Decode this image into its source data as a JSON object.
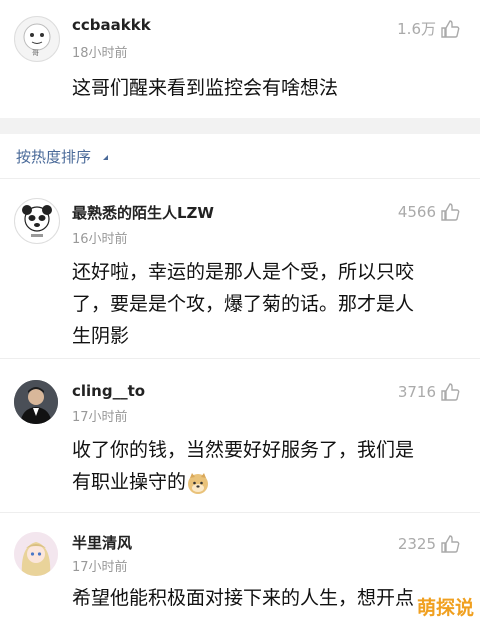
{
  "post": {
    "username": "ccbaakkk",
    "time": "18小时前",
    "likes": "1.6万",
    "text": "这哥们醒来看到监控会有啥想法",
    "avatar_caption": "哥"
  },
  "sort": {
    "label": "按热度排序"
  },
  "comments": [
    {
      "username": "最熟悉的陌生人LZW",
      "time": "16小时前",
      "likes": "4566",
      "lines": [
        "还好啦，幸运的是那人是个受，所以只咬",
        "了，要是是个攻，爆了菊的话。那才是人",
        "生阴影"
      ]
    },
    {
      "username": "cling__to",
      "time": "17小时前",
      "likes": "3716",
      "lines": [
        "收了你的钱，当然要好好服务了，我们是",
        "有职业操守的"
      ]
    },
    {
      "username": "半里清风",
      "time": "17小时前",
      "likes": "2325",
      "lines": [
        "希望他能积极面对接下来的人生，想开点"
      ]
    }
  ],
  "watermark": "萌探说",
  "colors": {
    "sort_accent": "#4a6a99",
    "meta_gray": "#999999",
    "watermark": "#f0a020"
  },
  "icons": [
    "thumbs-up-icon",
    "panda-meme-avatar",
    "man-in-suit-avatar",
    "anime-girl-avatar",
    "doge-emoji"
  ]
}
